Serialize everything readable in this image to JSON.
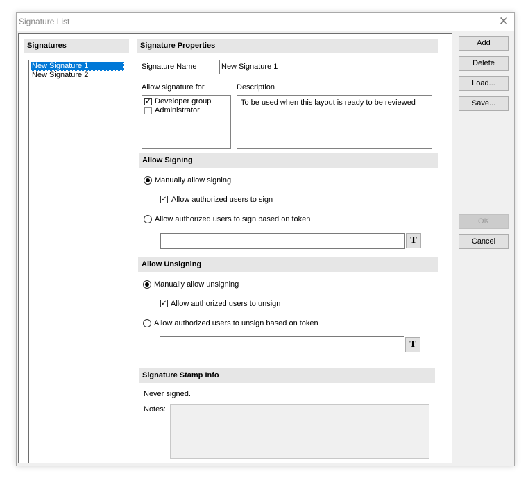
{
  "window": {
    "title": "Signature List",
    "close_glyph": "✕"
  },
  "signatures": {
    "header": "Signatures",
    "items": [
      {
        "label": "New Signature 1",
        "selected": true
      },
      {
        "label": "New Signature 2",
        "selected": false
      }
    ]
  },
  "properties": {
    "header": "Signature Properties",
    "name_label": "Signature Name",
    "name_value": "New Signature 1",
    "allow_for_label": "Allow signature for",
    "allow_for": [
      {
        "label": "Developer group",
        "checked": true
      },
      {
        "label": "Administrator",
        "checked": false
      }
    ],
    "description_label": "Description",
    "description_value": "To be used when this layout is ready to be reviewed"
  },
  "signing": {
    "header": "Allow Signing",
    "manual_label": "Manually allow signing",
    "authorized_label": "Allow authorized users to sign",
    "token_label": "Allow authorized users to sign based on token",
    "token_value": "",
    "token_button": "T"
  },
  "unsigning": {
    "header": "Allow Unsigning",
    "manual_label": "Manually allow unsigning",
    "authorized_label": "Allow authorized users to unsign",
    "token_label": "Allow authorized users to unsign based on token",
    "token_value": "",
    "token_button": "T"
  },
  "stamp": {
    "header": "Signature Stamp Info",
    "status": "Never signed.",
    "notes_label": "Notes:",
    "notes_value": ""
  },
  "buttons": {
    "add": "Add",
    "delete": "Delete",
    "load": "Load...",
    "save": "Save...",
    "ok": "OK",
    "cancel": "Cancel"
  },
  "checkmark_glyph": "✓"
}
